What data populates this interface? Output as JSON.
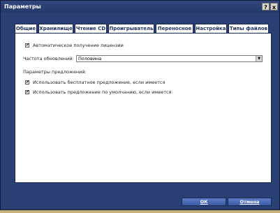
{
  "window": {
    "title": "Параметры",
    "help_label": "?",
    "close_label": "x"
  },
  "tabs": [
    {
      "label": "Общие"
    },
    {
      "label": "Хранилище"
    },
    {
      "label": "Чтение CD"
    },
    {
      "label": "Проигрыватель",
      "active": true
    },
    {
      "label": "Переносное"
    },
    {
      "label": "Настройка"
    },
    {
      "label": "Типы файлов"
    }
  ],
  "player": {
    "auto_license_label": "Автоматическое получение лицензии",
    "auto_license_checked": true,
    "update_freq_label": "Частота обновлений:",
    "update_freq_value": "Половина",
    "plugins_header": "Параметры предложений:",
    "free_offer_label": "Использовать бесплатное предложение, если имеется",
    "free_offer_checked": true,
    "default_offer_label": "Использовать предложение по умолчанию, если имеется",
    "default_offer_checked": true
  },
  "footer": {
    "ok_label": "ОК",
    "cancel_label": "Отмена"
  },
  "colors": {
    "window_bg": "#2a3f73",
    "desktop": "#c9b07a",
    "tab_text": "#1d2f5e"
  }
}
